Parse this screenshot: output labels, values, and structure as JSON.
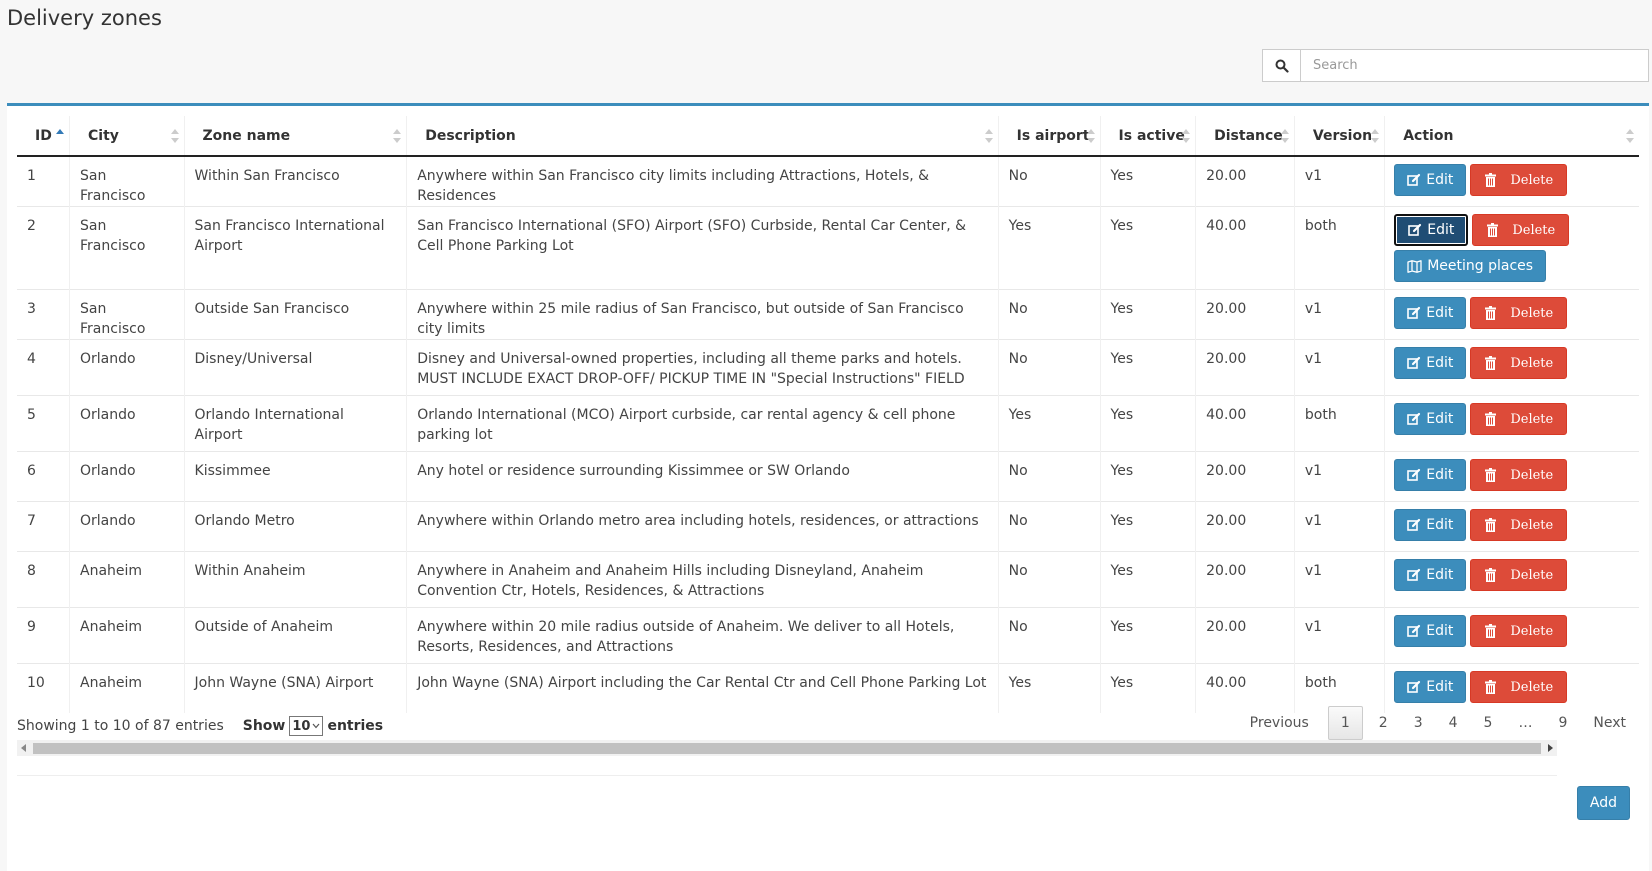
{
  "page": {
    "title": "Delivery zones"
  },
  "search": {
    "placeholder": "Search",
    "value": ""
  },
  "table": {
    "columns": [
      "ID",
      "City",
      "Zone name",
      "Description",
      "Is airport",
      "Is active",
      "Distance",
      "Version",
      "Action"
    ],
    "rows": [
      {
        "id": "1",
        "city": "San Francisco",
        "zone": "Within San Francisco",
        "description": "Anywhere within San Francisco city limits including Attractions, Hotels, & Residences",
        "airport": "No",
        "active": "Yes",
        "distance": "20.00",
        "version": "v1",
        "meeting": false
      },
      {
        "id": "2",
        "city": "San Francisco",
        "zone": "San Francisco International Airport",
        "description": "San Francisco International (SFO) Airport (SFO) Curbside, Rental Car Center, & Cell Phone Parking Lot",
        "airport": "Yes",
        "active": "Yes",
        "distance": "40.00",
        "version": "both",
        "meeting": true
      },
      {
        "id": "3",
        "city": "San Francisco",
        "zone": "Outside San Francisco",
        "description": "Anywhere within 25 mile radius of San Francisco, but outside of San Francisco city limits",
        "airport": "No",
        "active": "Yes",
        "distance": "20.00",
        "version": "v1",
        "meeting": false
      },
      {
        "id": "4",
        "city": "Orlando",
        "zone": "Disney/Universal",
        "description": "Disney and Universal-owned properties, including all theme parks and hotels. MUST INCLUDE EXACT DROP-OFF/ PICKUP TIME IN \"Special Instructions\" FIELD",
        "airport": "No",
        "active": "Yes",
        "distance": "20.00",
        "version": "v1",
        "meeting": false
      },
      {
        "id": "5",
        "city": "Orlando",
        "zone": "Orlando International Airport",
        "description": "Orlando International (MCO) Airport curbside, car rental agency & cell phone parking lot",
        "airport": "Yes",
        "active": "Yes",
        "distance": "40.00",
        "version": "both",
        "meeting": false
      },
      {
        "id": "6",
        "city": "Orlando",
        "zone": "Kissimmee",
        "description": "Any hotel or residence surrounding Kissimmee or SW Orlando",
        "airport": "No",
        "active": "Yes",
        "distance": "20.00",
        "version": "v1",
        "meeting": false
      },
      {
        "id": "7",
        "city": "Orlando",
        "zone": "Orlando Metro",
        "description": "Anywhere within Orlando metro area including hotels, residences, or attractions",
        "airport": "No",
        "active": "Yes",
        "distance": "20.00",
        "version": "v1",
        "meeting": false
      },
      {
        "id": "8",
        "city": "Anaheim",
        "zone": "Within Anaheim",
        "description": "Anywhere in Anaheim and Anaheim Hills including Disneyland, Anaheim Convention Ctr, Hotels, Residences, & Attractions",
        "airport": "No",
        "active": "Yes",
        "distance": "20.00",
        "version": "v1",
        "meeting": false
      },
      {
        "id": "9",
        "city": "Anaheim",
        "zone": "Outside of Anaheim",
        "description": "Anywhere within 20 mile radius outside of Anaheim. We deliver to all Hotels, Resorts, Residences, and Attractions",
        "airport": "No",
        "active": "Yes",
        "distance": "20.00",
        "version": "v1",
        "meeting": false
      },
      {
        "id": "10",
        "city": "Anaheim",
        "zone": "John Wayne (SNA) Airport",
        "description": "John Wayne (SNA) Airport including the Car Rental Ctr and Cell Phone Parking Lot",
        "airport": "Yes",
        "active": "Yes",
        "distance": "40.00",
        "version": "both",
        "meeting": false
      }
    ]
  },
  "buttons": {
    "edit": "Edit",
    "delete": "Delete",
    "meeting": "Meeting places",
    "add": "Add"
  },
  "footer": {
    "info": "Showing 1 to 10 of 87 entries",
    "show_label": "Show",
    "page_length": "10",
    "entries_label": "entries"
  },
  "pagination": {
    "previous": "Previous",
    "pages": [
      "1",
      "2",
      "3",
      "4",
      "5",
      "…",
      "9"
    ],
    "current": "1",
    "next": "Next"
  },
  "colors": {
    "accent": "#3c8dbc",
    "danger": "#dd4b39",
    "active_edit": "#204d74"
  },
  "icons": {
    "search": "search-icon",
    "edit": "edit-icon",
    "delete": "trash-icon",
    "meeting": "map-icon"
  }
}
